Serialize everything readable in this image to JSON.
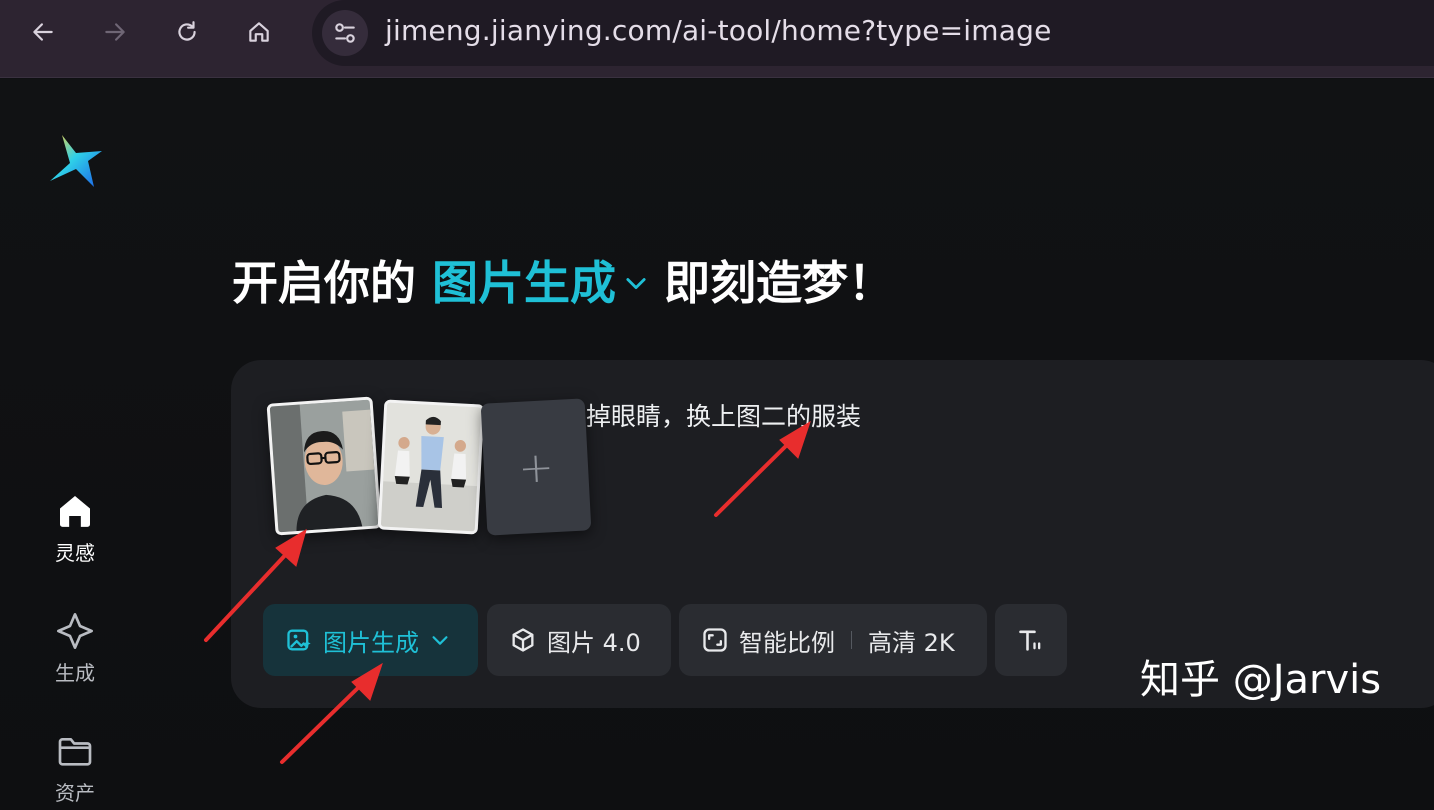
{
  "browser": {
    "url": "jimeng.jianying.com/ai-tool/home?type=image",
    "back_icon": "arrow-left-icon",
    "forward_icon": "arrow-right-icon",
    "reload_icon": "reload-icon",
    "home_icon": "home-icon",
    "site_info_icon": "tune-icon"
  },
  "sidebar": {
    "items": [
      {
        "label": "灵感",
        "icon": "home-icon",
        "active": true
      },
      {
        "label": "生成",
        "icon": "sparkle-icon",
        "active": false
      },
      {
        "label": "资产",
        "icon": "folder-icon",
        "active": false
      }
    ]
  },
  "headline": {
    "prefix": "开启你的",
    "mode": "图片生成",
    "suffix": "即刻造梦！"
  },
  "prompt": {
    "text": "图一中的男人扔掉眼睛，换上图二的服装",
    "visible_text": "扔掉眼睛，换上图二的服装"
  },
  "uploads": {
    "add_label": "+"
  },
  "toolbar": {
    "mode_label": "图片生成",
    "model_label": "图片 4.0",
    "ratio_label": "智能比例",
    "quality_label": "高清 2K"
  },
  "watermark": "知乎 @Jarvis",
  "colors": {
    "accent": "#1fc0d6",
    "annotation_arrow": "#e82d2d"
  }
}
